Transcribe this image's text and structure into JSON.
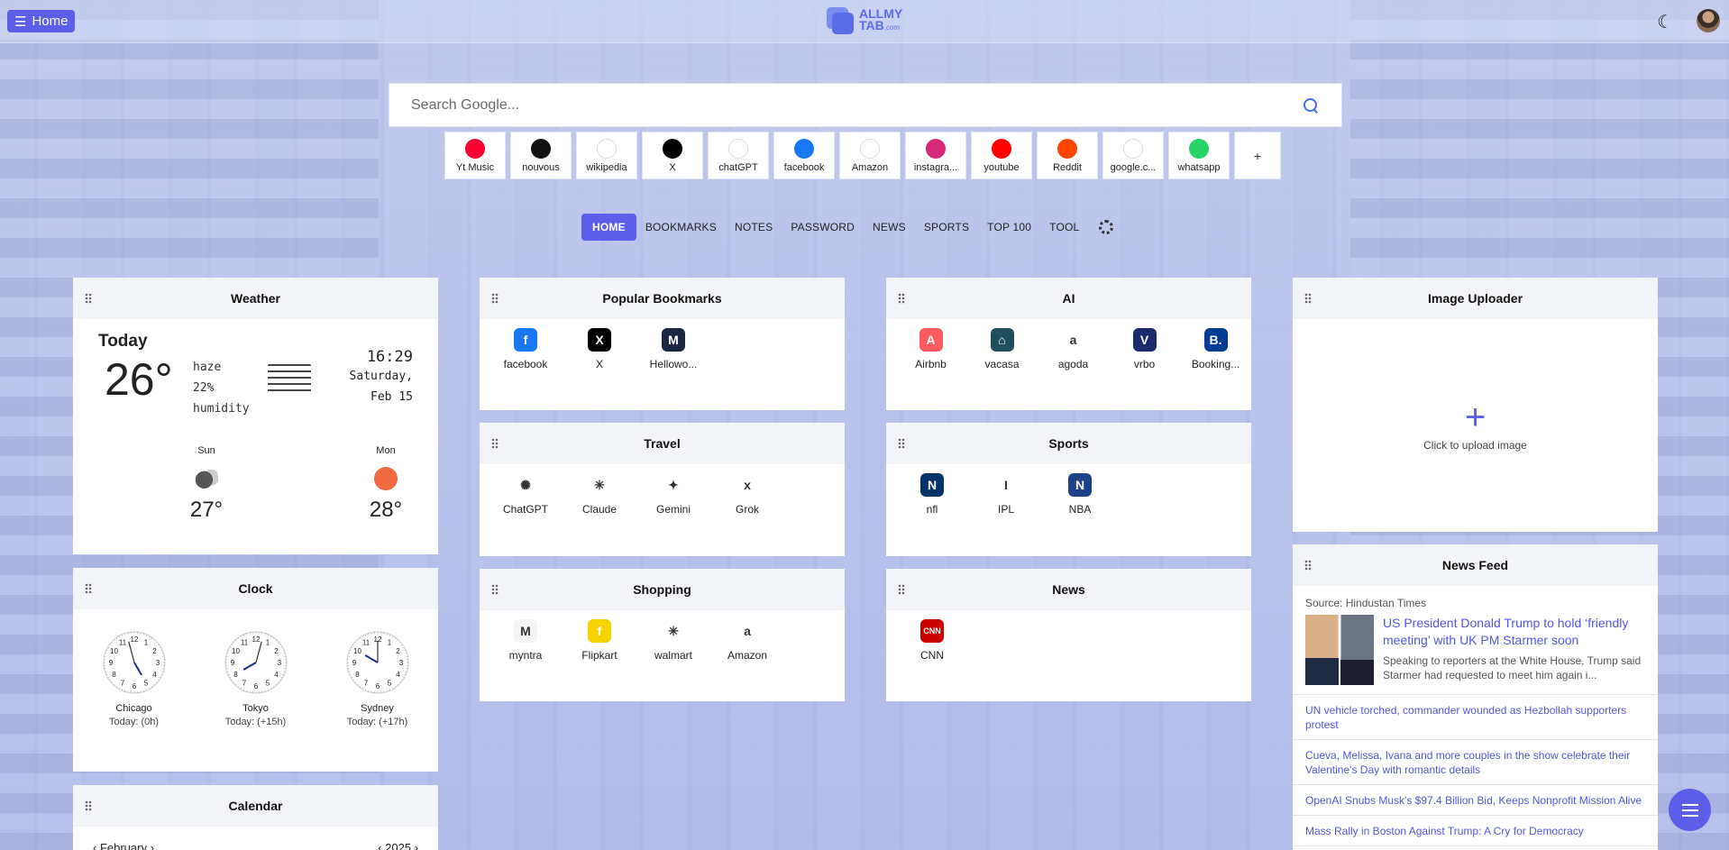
{
  "topbar": {
    "home_label": "Home",
    "logo_line1": "ALLMY",
    "logo_line2": "TAB",
    "logo_suffix": ".com"
  },
  "search": {
    "placeholder": "Search Google..."
  },
  "shortcuts": [
    {
      "label": "Yt Music",
      "icon": "yt-music-icon",
      "color": "#ff0033"
    },
    {
      "label": "nouvous",
      "icon": "nouvous-icon",
      "color": "#111111"
    },
    {
      "label": "wikipedia",
      "icon": "wikipedia-icon",
      "color": "#ffffff"
    },
    {
      "label": "X",
      "icon": "x-icon",
      "color": "#000000"
    },
    {
      "label": "chatGPT",
      "icon": "chatgpt-icon",
      "color": "#ffffff"
    },
    {
      "label": "facebook",
      "icon": "facebook-icon",
      "color": "#1877f2"
    },
    {
      "label": "Amazon",
      "icon": "amazon-icon",
      "color": "#ffffff"
    },
    {
      "label": "instagra...",
      "icon": "instagram-icon",
      "color": "#d62976"
    },
    {
      "label": "youtube",
      "icon": "youtube-icon",
      "color": "#ff0000"
    },
    {
      "label": "Reddit",
      "icon": "reddit-icon",
      "color": "#ff4500"
    },
    {
      "label": "google.c...",
      "icon": "google-icon",
      "color": "#ffffff"
    },
    {
      "label": "whatsapp",
      "icon": "whatsapp-icon",
      "color": "#25d366"
    }
  ],
  "add_shortcut_label": "+",
  "tabs": [
    "HOME",
    "BOOKMARKS",
    "NOTES",
    "PASSWORD",
    "NEWS",
    "SPORTS",
    "TOP 100",
    "TOOL"
  ],
  "weather": {
    "title": "Weather",
    "today_label": "Today",
    "temp": "26°",
    "condition": "haze",
    "humidity_value": "22%",
    "humidity_label": "humidity",
    "time": "16:29",
    "date_line1": "Saturday,",
    "date_line2": "Feb 15",
    "forecast": [
      {
        "day": "Sun",
        "temp": "27°",
        "icon": "cloud-night-icon"
      },
      {
        "day": "Mon",
        "temp": "28°",
        "icon": "sun-icon"
      }
    ]
  },
  "clock": {
    "title": "Clock",
    "clocks": [
      {
        "city": "Chicago",
        "offset": "Today: (0h)"
      },
      {
        "city": "Tokyo",
        "offset": "Today: (+15h)"
      },
      {
        "city": "Sydney",
        "offset": "Today: (+17h)"
      }
    ]
  },
  "calendar": {
    "title": "Calendar",
    "month": "February",
    "year": "2025"
  },
  "popular_bookmarks": {
    "title": "Popular Bookmarks",
    "items": [
      {
        "label": "facebook",
        "color": "#1877f2",
        "glyph": "f"
      },
      {
        "label": "X",
        "color": "#000000",
        "glyph": "X"
      },
      {
        "label": "Hellowo...",
        "color": "#1c2541",
        "glyph": "M"
      }
    ]
  },
  "travel": {
    "title": "Travel",
    "items": [
      {
        "label": "ChatGPT",
        "color": "#ffffff",
        "glyph": "✺"
      },
      {
        "label": "Claude",
        "color": "#ffffff",
        "glyph": "✳"
      },
      {
        "label": "Gemini",
        "color": "#ffffff",
        "glyph": "✦"
      },
      {
        "label": "Grok",
        "color": "#ffffff",
        "glyph": "x"
      }
    ]
  },
  "shopping": {
    "title": "Shopping",
    "items": [
      {
        "label": "myntra",
        "color": "#f4f4f6",
        "glyph": "M"
      },
      {
        "label": "Flipkart",
        "color": "#f7d400",
        "glyph": "f"
      },
      {
        "label": "walmart",
        "color": "#ffffff",
        "glyph": "✳"
      },
      {
        "label": "Amazon",
        "color": "#ffffff",
        "glyph": "a"
      }
    ]
  },
  "ai": {
    "title": "AI",
    "items": [
      {
        "label": "Airbnb",
        "color": "#ff5a5f",
        "glyph": "A"
      },
      {
        "label": "vacasa",
        "color": "#1f4e5f",
        "glyph": "⌂"
      },
      {
        "label": "agoda",
        "color": "#ffffff",
        "glyph": "a"
      },
      {
        "label": "vrbo",
        "color": "#1b2a6b",
        "glyph": "V"
      },
      {
        "label": "Booking...",
        "color": "#003b95",
        "glyph": "B."
      }
    ]
  },
  "sports": {
    "title": "Sports",
    "items": [
      {
        "label": "nfl",
        "color": "#013369",
        "glyph": "N"
      },
      {
        "label": "IPL",
        "color": "#ffffff",
        "glyph": "I"
      },
      {
        "label": "NBA",
        "color": "#1d428a",
        "glyph": "N"
      }
    ]
  },
  "news_bookmarks": {
    "title": "News",
    "items": [
      {
        "label": "CNN",
        "color": "#cc0000",
        "glyph": "CNN"
      }
    ]
  },
  "image_uploader": {
    "title": "Image Uploader",
    "plus": "+",
    "hint": "Click to upload image"
  },
  "news_feed": {
    "title": "News Feed",
    "source": "Source: Hindustan Times",
    "top_title": "US President Donald Trump to hold ‘friendly meeting’ with UK PM Starmer soon",
    "top_desc": "Speaking to reporters at the White House, Trump said Starmer had requested to meet him again i...",
    "links": [
      "UN vehicle torched, commander wounded as Hezbollah supporters protest",
      "Cueva, Melissa, Ivana and more couples in the show celebrate their Valentine's Day with romantic details",
      "OpenAI Snubs Musk's $97.4 Billion Bid, Keeps Nonprofit Mission Alive",
      "Mass Rally in Boston Against Trump: A Cry for Democracy"
    ]
  },
  "colors": {
    "accent": "#5b5ee8",
    "link": "#5457e0"
  }
}
